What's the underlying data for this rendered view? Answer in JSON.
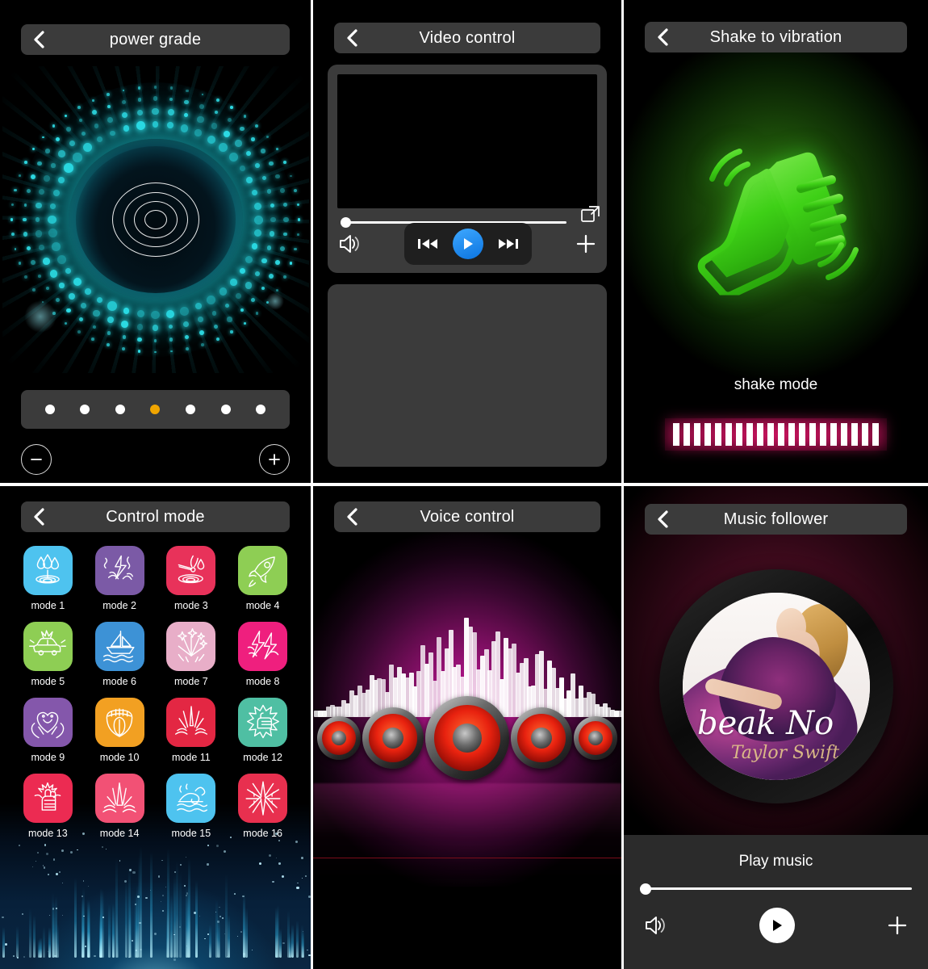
{
  "panels": {
    "power_grade": {
      "title": "power grade",
      "back_icon": "chevron-left-icon",
      "level_dots": {
        "count": 7,
        "active_index": 3,
        "active_color": "#f0a500",
        "inactive_color": "#ffffff"
      },
      "minus_label": "−",
      "plus_label": "+",
      "art": "glowing-cyan-ring-orb"
    },
    "video_control": {
      "title": "Video control",
      "back_icon": "chevron-left-icon",
      "progress_percent": 0,
      "buttons": {
        "volume": "speaker-icon",
        "previous": "skip-previous-icon",
        "play": "play-icon",
        "next": "skip-next-icon",
        "add": "plus-icon",
        "fullscreen": "expand-icon"
      },
      "accent_color": "#1e8ff5"
    },
    "shake_to_vibration": {
      "title": "Shake to vibration",
      "back_icon": "chevron-left-icon",
      "mode_label": "shake mode",
      "icon": "hand-shaking-phone-icon",
      "icon_color": "#45d520",
      "vibration_bars": 20,
      "vibration_glow_color": "#eb146e"
    },
    "control_mode": {
      "title": "Control mode",
      "back_icon": "chevron-left-icon",
      "modes": [
        {
          "label": "mode 1",
          "color": "#4ec3ef",
          "icon": "water-drops-icon"
        },
        {
          "label": "mode 2",
          "color": "#7b5aa6",
          "icon": "lightning-crack-icon"
        },
        {
          "label": "mode 3",
          "color": "#e8325a",
          "icon": "dragonfly-water-icon"
        },
        {
          "label": "mode 4",
          "color": "#8ece54",
          "icon": "rocket-icon"
        },
        {
          "label": "mode 5",
          "color": "#8ece54",
          "icon": "car-crash-icon"
        },
        {
          "label": "mode 6",
          "color": "#3d92d6",
          "icon": "sailboat-icon"
        },
        {
          "label": "mode 7",
          "color": "#e8aec8",
          "icon": "fireworks-icon"
        },
        {
          "label": "mode 8",
          "color": "#ef1f7e",
          "icon": "double-bolt-icon"
        },
        {
          "label": "mode 9",
          "color": "#8457ab",
          "icon": "heart-hands-icon"
        },
        {
          "label": "mode 10",
          "color": "#f2a022",
          "icon": "tongue-mouth-icon"
        },
        {
          "label": "mode 11",
          "color": "#e32743",
          "icon": "eruption-icon"
        },
        {
          "label": "mode 12",
          "color": "#4fbfa3",
          "icon": "fist-burst-icon"
        },
        {
          "label": "mode 13",
          "color": "#ec2b52",
          "icon": "raised-fist-icon"
        },
        {
          "label": "mode 14",
          "color": "#f25175",
          "icon": "shard-impact-icon"
        },
        {
          "label": "mode 15",
          "color": "#4ec3ef",
          "icon": "wind-wave-icon"
        },
        {
          "label": "mode 16",
          "color": "#e8304f",
          "icon": "shatter-burst-icon"
        }
      ]
    },
    "voice_control": {
      "title": "Voice control",
      "back_icon": "chevron-left-icon",
      "art": "red-speakers-equalizer"
    },
    "music_follower": {
      "title": "Music follower",
      "back_icon": "chevron-left-icon",
      "play_label": "Play music",
      "progress_percent": 0,
      "album_script": "beak No",
      "album_script2": "Taylor Swift",
      "buttons": {
        "volume": "speaker-icon",
        "play": "play-icon",
        "add": "plus-icon"
      }
    }
  }
}
